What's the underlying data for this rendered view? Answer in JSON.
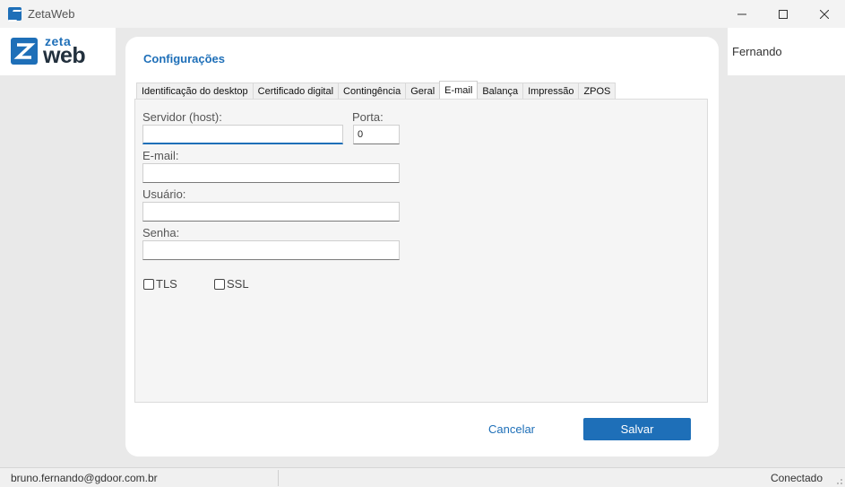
{
  "window": {
    "title": "ZetaWeb",
    "controls": {
      "minimize": "minimize-icon",
      "maximize": "maximize-icon",
      "close": "close-icon"
    }
  },
  "logo": {
    "zeta": "zeta",
    "web": "web"
  },
  "header": {
    "user": "Fernando"
  },
  "dialog": {
    "title": "Configurações",
    "tabs": [
      {
        "label": "Identificação do desktop",
        "active": false
      },
      {
        "label": "Certificado digital",
        "active": false
      },
      {
        "label": "Contingência",
        "active": false
      },
      {
        "label": "Geral",
        "active": false
      },
      {
        "label": "E-mail",
        "active": true
      },
      {
        "label": "Balança",
        "active": false
      },
      {
        "label": "Impressão",
        "active": false
      },
      {
        "label": "ZPOS",
        "active": false
      }
    ],
    "form": {
      "server_label": "Servidor (host):",
      "server_value": "",
      "port_label": "Porta:",
      "port_value": "0",
      "email_label": "E-mail:",
      "email_value": "",
      "user_label": "Usuário:",
      "user_value": "",
      "password_label": "Senha:",
      "password_value": "",
      "tls_label": "TLS",
      "tls_checked": false,
      "ssl_label": "SSL",
      "ssl_checked": false
    },
    "cancel_label": "Cancelar",
    "save_label": "Salvar"
  },
  "statusbar": {
    "email": "bruno.fernando@gdoor.com.br",
    "state": "Conectado"
  },
  "colors": {
    "accent": "#1e6fb8",
    "background": "#e9e9e9"
  }
}
